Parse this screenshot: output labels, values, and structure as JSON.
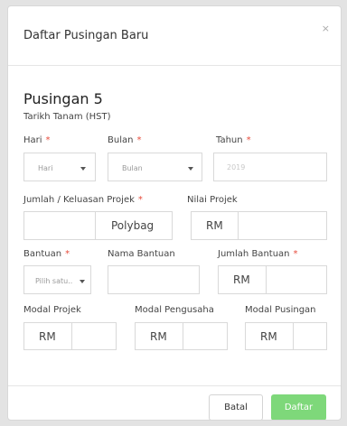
{
  "modal": {
    "title": "Daftar Pusingan Baru",
    "close_label": "×"
  },
  "form": {
    "section_title": "Pusingan 5",
    "planting_date_label": "Tarikh Tanam (HST)",
    "required_mark": "*",
    "day": {
      "label": "Hari",
      "selected": "Hari"
    },
    "month": {
      "label": "Bulan",
      "selected": "Bulan"
    },
    "year": {
      "label": "Tahun",
      "placeholder": "2019"
    },
    "project_area": {
      "label": "Jumlah / Keluasan Projek",
      "value": "",
      "unit": "Polybag"
    },
    "project_value": {
      "label": "Nilai Projek",
      "prefix": "RM",
      "value": ""
    },
    "aid": {
      "label": "Bantuan",
      "selected": "Pilih satu.."
    },
    "aid_name": {
      "label": "Nama Bantuan",
      "value": ""
    },
    "aid_amount": {
      "label": "Jumlah Bantuan",
      "prefix": "RM",
      "value": ""
    },
    "project_capital": {
      "label": "Modal Projek",
      "prefix": "RM",
      "value": ""
    },
    "entrepreneur_capital": {
      "label": "Modal Pengusaha",
      "prefix": "RM",
      "value": ""
    },
    "round_capital": {
      "label": "Modal Pusingan",
      "prefix": "RM",
      "value": ""
    }
  },
  "footer": {
    "cancel_label": "Batal",
    "submit_label": "Daftar"
  },
  "colors": {
    "primary": "#7ed87a",
    "required": "#e74c3c",
    "backdrop": "#e3e3e3"
  }
}
